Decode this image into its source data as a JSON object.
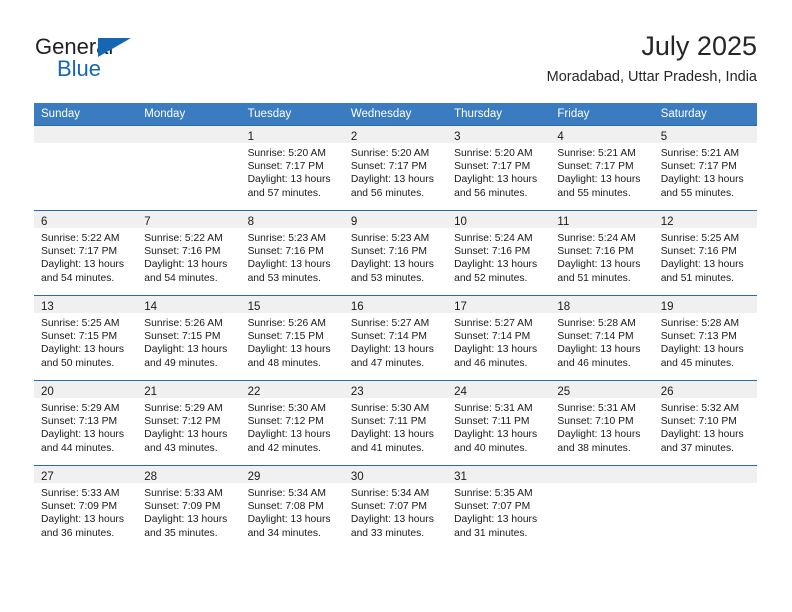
{
  "brand": {
    "name_part1": "General",
    "name_part2": "Blue",
    "accent_color": "#1567b2"
  },
  "header": {
    "title": "July 2025",
    "subtitle": "Moradabad, Uttar Pradesh, India"
  },
  "theme": {
    "header_row_bg": "#3b7cc0",
    "row_divider": "#2c6aa8",
    "daynum_band_bg": "#f0f0f0",
    "text": "#1a1a1a"
  },
  "weekday_headers": [
    "Sunday",
    "Monday",
    "Tuesday",
    "Wednesday",
    "Thursday",
    "Friday",
    "Saturday"
  ],
  "weeks": [
    [
      {
        "day": "",
        "sunrise": "",
        "sunset": "",
        "daylight": ""
      },
      {
        "day": "",
        "sunrise": "",
        "sunset": "",
        "daylight": ""
      },
      {
        "day": "1",
        "sunrise": "Sunrise: 5:20 AM",
        "sunset": "Sunset: 7:17 PM",
        "daylight": "Daylight: 13 hours and 57 minutes."
      },
      {
        "day": "2",
        "sunrise": "Sunrise: 5:20 AM",
        "sunset": "Sunset: 7:17 PM",
        "daylight": "Daylight: 13 hours and 56 minutes."
      },
      {
        "day": "3",
        "sunrise": "Sunrise: 5:20 AM",
        "sunset": "Sunset: 7:17 PM",
        "daylight": "Daylight: 13 hours and 56 minutes."
      },
      {
        "day": "4",
        "sunrise": "Sunrise: 5:21 AM",
        "sunset": "Sunset: 7:17 PM",
        "daylight": "Daylight: 13 hours and 55 minutes."
      },
      {
        "day": "5",
        "sunrise": "Sunrise: 5:21 AM",
        "sunset": "Sunset: 7:17 PM",
        "daylight": "Daylight: 13 hours and 55 minutes."
      }
    ],
    [
      {
        "day": "6",
        "sunrise": "Sunrise: 5:22 AM",
        "sunset": "Sunset: 7:17 PM",
        "daylight": "Daylight: 13 hours and 54 minutes."
      },
      {
        "day": "7",
        "sunrise": "Sunrise: 5:22 AM",
        "sunset": "Sunset: 7:16 PM",
        "daylight": "Daylight: 13 hours and 54 minutes."
      },
      {
        "day": "8",
        "sunrise": "Sunrise: 5:23 AM",
        "sunset": "Sunset: 7:16 PM",
        "daylight": "Daylight: 13 hours and 53 minutes."
      },
      {
        "day": "9",
        "sunrise": "Sunrise: 5:23 AM",
        "sunset": "Sunset: 7:16 PM",
        "daylight": "Daylight: 13 hours and 53 minutes."
      },
      {
        "day": "10",
        "sunrise": "Sunrise: 5:24 AM",
        "sunset": "Sunset: 7:16 PM",
        "daylight": "Daylight: 13 hours and 52 minutes."
      },
      {
        "day": "11",
        "sunrise": "Sunrise: 5:24 AM",
        "sunset": "Sunset: 7:16 PM",
        "daylight": "Daylight: 13 hours and 51 minutes."
      },
      {
        "day": "12",
        "sunrise": "Sunrise: 5:25 AM",
        "sunset": "Sunset: 7:16 PM",
        "daylight": "Daylight: 13 hours and 51 minutes."
      }
    ],
    [
      {
        "day": "13",
        "sunrise": "Sunrise: 5:25 AM",
        "sunset": "Sunset: 7:15 PM",
        "daylight": "Daylight: 13 hours and 50 minutes."
      },
      {
        "day": "14",
        "sunrise": "Sunrise: 5:26 AM",
        "sunset": "Sunset: 7:15 PM",
        "daylight": "Daylight: 13 hours and 49 minutes."
      },
      {
        "day": "15",
        "sunrise": "Sunrise: 5:26 AM",
        "sunset": "Sunset: 7:15 PM",
        "daylight": "Daylight: 13 hours and 48 minutes."
      },
      {
        "day": "16",
        "sunrise": "Sunrise: 5:27 AM",
        "sunset": "Sunset: 7:14 PM",
        "daylight": "Daylight: 13 hours and 47 minutes."
      },
      {
        "day": "17",
        "sunrise": "Sunrise: 5:27 AM",
        "sunset": "Sunset: 7:14 PM",
        "daylight": "Daylight: 13 hours and 46 minutes."
      },
      {
        "day": "18",
        "sunrise": "Sunrise: 5:28 AM",
        "sunset": "Sunset: 7:14 PM",
        "daylight": "Daylight: 13 hours and 46 minutes."
      },
      {
        "day": "19",
        "sunrise": "Sunrise: 5:28 AM",
        "sunset": "Sunset: 7:13 PM",
        "daylight": "Daylight: 13 hours and 45 minutes."
      }
    ],
    [
      {
        "day": "20",
        "sunrise": "Sunrise: 5:29 AM",
        "sunset": "Sunset: 7:13 PM",
        "daylight": "Daylight: 13 hours and 44 minutes."
      },
      {
        "day": "21",
        "sunrise": "Sunrise: 5:29 AM",
        "sunset": "Sunset: 7:12 PM",
        "daylight": "Daylight: 13 hours and 43 minutes."
      },
      {
        "day": "22",
        "sunrise": "Sunrise: 5:30 AM",
        "sunset": "Sunset: 7:12 PM",
        "daylight": "Daylight: 13 hours and 42 minutes."
      },
      {
        "day": "23",
        "sunrise": "Sunrise: 5:30 AM",
        "sunset": "Sunset: 7:11 PM",
        "daylight": "Daylight: 13 hours and 41 minutes."
      },
      {
        "day": "24",
        "sunrise": "Sunrise: 5:31 AM",
        "sunset": "Sunset: 7:11 PM",
        "daylight": "Daylight: 13 hours and 40 minutes."
      },
      {
        "day": "25",
        "sunrise": "Sunrise: 5:31 AM",
        "sunset": "Sunset: 7:10 PM",
        "daylight": "Daylight: 13 hours and 38 minutes."
      },
      {
        "day": "26",
        "sunrise": "Sunrise: 5:32 AM",
        "sunset": "Sunset: 7:10 PM",
        "daylight": "Daylight: 13 hours and 37 minutes."
      }
    ],
    [
      {
        "day": "27",
        "sunrise": "Sunrise: 5:33 AM",
        "sunset": "Sunset: 7:09 PM",
        "daylight": "Daylight: 13 hours and 36 minutes."
      },
      {
        "day": "28",
        "sunrise": "Sunrise: 5:33 AM",
        "sunset": "Sunset: 7:09 PM",
        "daylight": "Daylight: 13 hours and 35 minutes."
      },
      {
        "day": "29",
        "sunrise": "Sunrise: 5:34 AM",
        "sunset": "Sunset: 7:08 PM",
        "daylight": "Daylight: 13 hours and 34 minutes."
      },
      {
        "day": "30",
        "sunrise": "Sunrise: 5:34 AM",
        "sunset": "Sunset: 7:07 PM",
        "daylight": "Daylight: 13 hours and 33 minutes."
      },
      {
        "day": "31",
        "sunrise": "Sunrise: 5:35 AM",
        "sunset": "Sunset: 7:07 PM",
        "daylight": "Daylight: 13 hours and 31 minutes."
      },
      {
        "day": "",
        "sunrise": "",
        "sunset": "",
        "daylight": ""
      },
      {
        "day": "",
        "sunrise": "",
        "sunset": "",
        "daylight": ""
      }
    ]
  ]
}
